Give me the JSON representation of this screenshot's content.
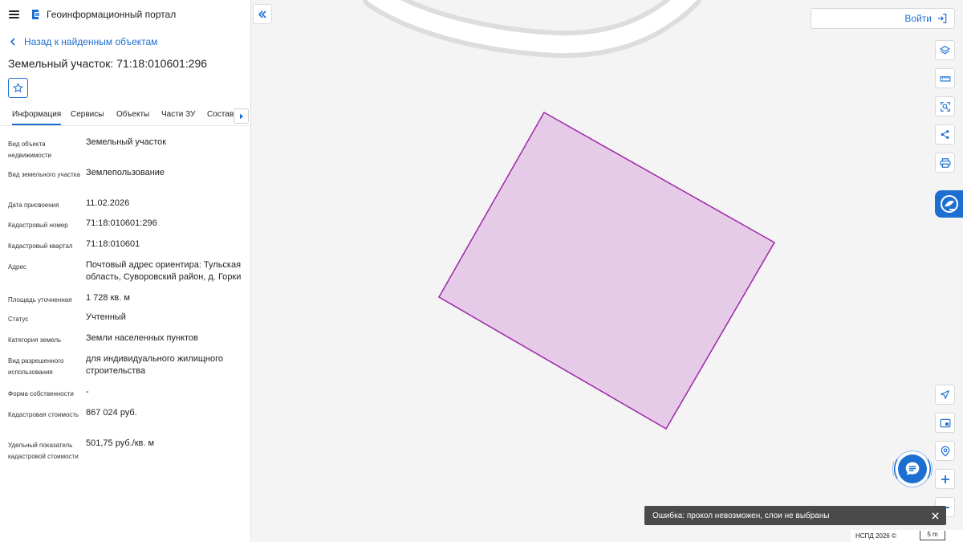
{
  "app": {
    "title": "Геоинформационный портал"
  },
  "nav": {
    "back_label": "Назад к найденным объектам"
  },
  "object": {
    "title": "Земельный участок: 71:18:010601:296"
  },
  "tabs": [
    {
      "label": "Информация"
    },
    {
      "label": "Сервисы"
    },
    {
      "label": "Объекты"
    },
    {
      "label": "Части ЗУ"
    },
    {
      "label": "Состав"
    }
  ],
  "properties": [
    {
      "label": "Вид объекта недвижимости",
      "value": "Земельный участок"
    },
    {
      "label": "Вид земельного участка",
      "value": "Землепользование"
    },
    {
      "label": "Дата присвоения",
      "value": "11.02.2026"
    },
    {
      "label": "Кадастровый номер",
      "value": "71:18:010601:296"
    },
    {
      "label": "Кадастровый квартал",
      "value": "71:18:010601"
    },
    {
      "label": "Адрес",
      "value": "Почтовый адрес ориентира: Тульская область, Суворовский район, д. Горки"
    },
    {
      "label": "Площадь уточненная",
      "value": "1 728 кв. м"
    },
    {
      "label": "Статус",
      "value": "Учтенный"
    },
    {
      "label": "Категория земель",
      "value": "Земли населенных пунктов"
    },
    {
      "label": "Вид разрешенного использования",
      "value": "для индивидуального жилищного строительства"
    },
    {
      "label": "Форма собственности",
      "value": "-"
    },
    {
      "label": "Кадастровая стоимость",
      "value": "867 024 руб."
    },
    {
      "label": "Удельный показатель кадастровой стоимости",
      "value": "501,75 руб./кв. м"
    }
  ],
  "header": {
    "login_label": "Войти"
  },
  "toast": {
    "message": "Ошибка: прокол невозможен, слои не выбраны"
  },
  "footer": {
    "copyright": "НСПД 2026 ©",
    "scale": "5 m"
  },
  "colors": {
    "accent": "#1c6fd1",
    "parcel_fill": "#e6cbe8",
    "parcel_stroke": "#9c27a8"
  },
  "icons": {
    "menu": "hamburger-icon",
    "logo": "logo-icon",
    "back": "chevron-left-icon",
    "favorite": "star-icon",
    "tabs_next": "chevron-right-icon",
    "collapse": "double-chevron-left-icon",
    "login": "login-icon",
    "tools": [
      "layers-icon",
      "ruler-icon",
      "select-area-icon",
      "share-icon",
      "print-icon",
      "locate-icon",
      "minimap-icon",
      "find-location-icon",
      "zoom-in-icon",
      "zoom-out-icon"
    ],
    "support": "support-icon",
    "chat": "chat-icon",
    "close": "close-icon"
  }
}
